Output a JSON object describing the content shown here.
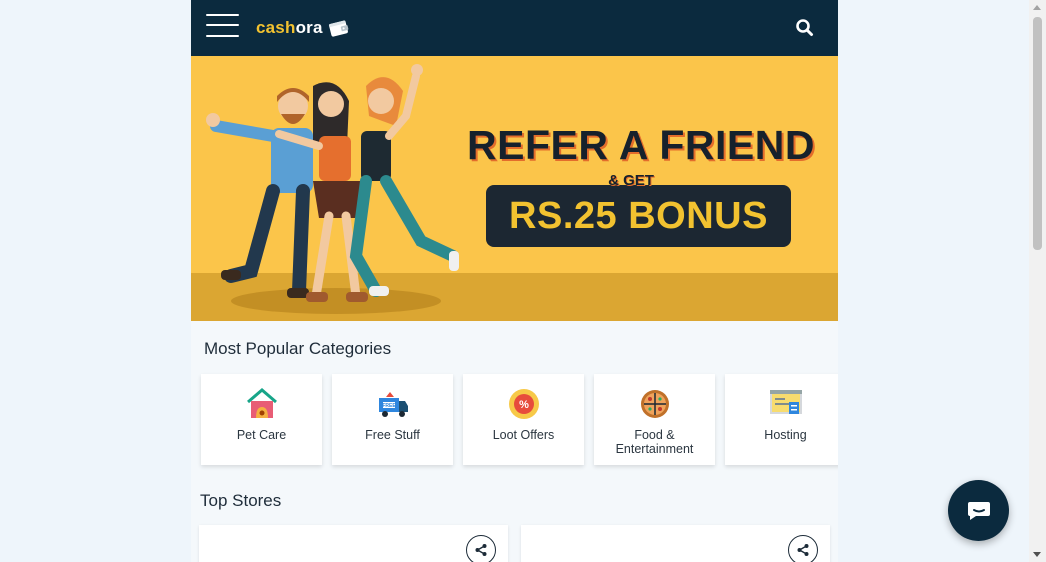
{
  "header": {
    "logo_part1": "cash",
    "logo_part2": "ora",
    "menu_icon": "hamburger-menu-icon",
    "search_icon": "search-icon",
    "wallet_icon": "wallet-icon"
  },
  "banner": {
    "headline": "REFER A FRIEND",
    "subline": "& GET",
    "bonus": "RS.25 BONUS"
  },
  "categories": {
    "title": "Most Popular Categories",
    "items": [
      {
        "label": "Pet Care",
        "icon": "pet-house-icon"
      },
      {
        "label": "Free Stuff",
        "icon": "free-delivery-truck-icon"
      },
      {
        "label": "Loot Offers",
        "icon": "discount-badge-icon"
      },
      {
        "label": "Food &\nEntertainment",
        "icon": "pizza-icon"
      },
      {
        "label": "Hosting",
        "icon": "hosting-monitor-icon"
      }
    ]
  },
  "top_stores": {
    "title": "Top Stores",
    "share_icon": "share-icon"
  },
  "chat": {
    "icon": "chat-bubble-icon"
  },
  "colors": {
    "header_bg": "#0b2a3e",
    "brand_yellow": "#f2c230",
    "banner_bg": "#fbc54a",
    "page_bg": "#f4f8fb"
  }
}
